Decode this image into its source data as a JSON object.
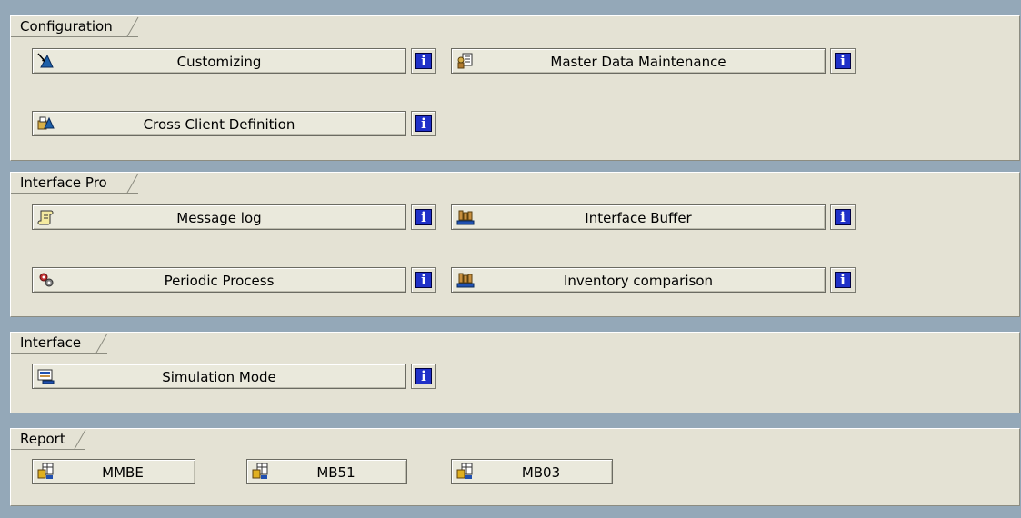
{
  "groups": [
    {
      "title": "Configuration",
      "buttons": [
        {
          "label": "Customizing",
          "icon": "customizing-icon"
        },
        {
          "label": "Master Data Maintenance",
          "icon": "master-data-icon"
        },
        {
          "label": "Cross Client Definition",
          "icon": "cross-client-icon"
        }
      ]
    },
    {
      "title": "Interface Pro",
      "buttons": [
        {
          "label": "Message log",
          "icon": "message-log-icon"
        },
        {
          "label": "Interface Buffer",
          "icon": "interface-buffer-icon"
        },
        {
          "label": "Periodic Process",
          "icon": "periodic-process-icon"
        },
        {
          "label": "Inventory comparison",
          "icon": "inventory-comparison-icon"
        }
      ]
    },
    {
      "title": "Interface",
      "buttons": [
        {
          "label": "Simulation Mode",
          "icon": "simulation-mode-icon"
        }
      ]
    },
    {
      "title": "Report",
      "buttons": [
        {
          "label": "MMBE",
          "icon": "report-icon"
        },
        {
          "label": "MB51",
          "icon": "report-icon"
        },
        {
          "label": "MB03",
          "icon": "report-icon"
        }
      ]
    }
  ],
  "info_glyph": "i",
  "colors": {
    "background": "#94a8b8",
    "group_background": "#e4e2d4",
    "info_blue": "#1f30c8"
  }
}
